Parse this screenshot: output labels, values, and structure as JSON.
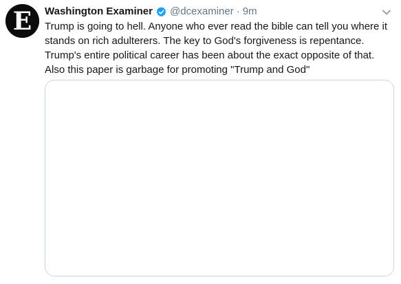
{
  "tweet": {
    "display_name": "Washington Examiner",
    "handle": "@dcexaminer",
    "separator": "·",
    "time": "9m",
    "text_line1": "Trump is going to hell. Anyone who ever read the bible can tell you where it stands on rich adulterers. The key to God's forgiveness is repentance. Trump's entire political career has been about the exact opposite of that.",
    "text_line2": "Also this paper is garbage for promoting \"Trump and God\"",
    "avatar_letter": "E"
  },
  "icons": {
    "verified": "verified-badge-icon",
    "more": "chevron-down-icon"
  },
  "colors": {
    "name": "#14171a",
    "secondary": "#657786",
    "verified_blue": "#1da1f2",
    "card_border": "#ccd6dd"
  }
}
